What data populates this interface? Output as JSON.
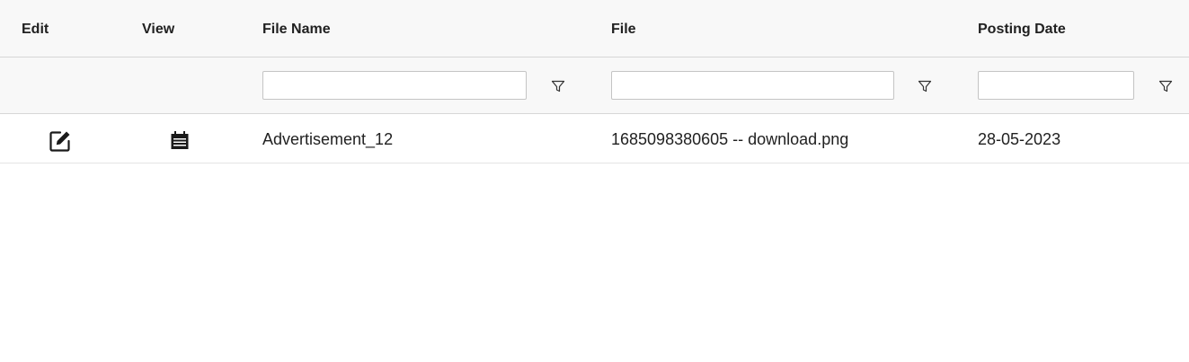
{
  "columns": {
    "edit": "Edit",
    "view": "View",
    "file_name": "File Name",
    "file": "File",
    "posting_date": "Posting Date"
  },
  "filters": {
    "file_name": {
      "value": "",
      "icon": "filter-icon"
    },
    "file": {
      "value": "",
      "icon": "filter-icon"
    },
    "posting_date": {
      "value": "",
      "icon": "filter-icon"
    }
  },
  "rows": [
    {
      "edit_icon": "edit-icon",
      "view_icon": "view-document-icon",
      "file_name": "Advertisement_12",
      "file": "1685098380605 -- download.png",
      "posting_date": "28-05-2023"
    }
  ]
}
